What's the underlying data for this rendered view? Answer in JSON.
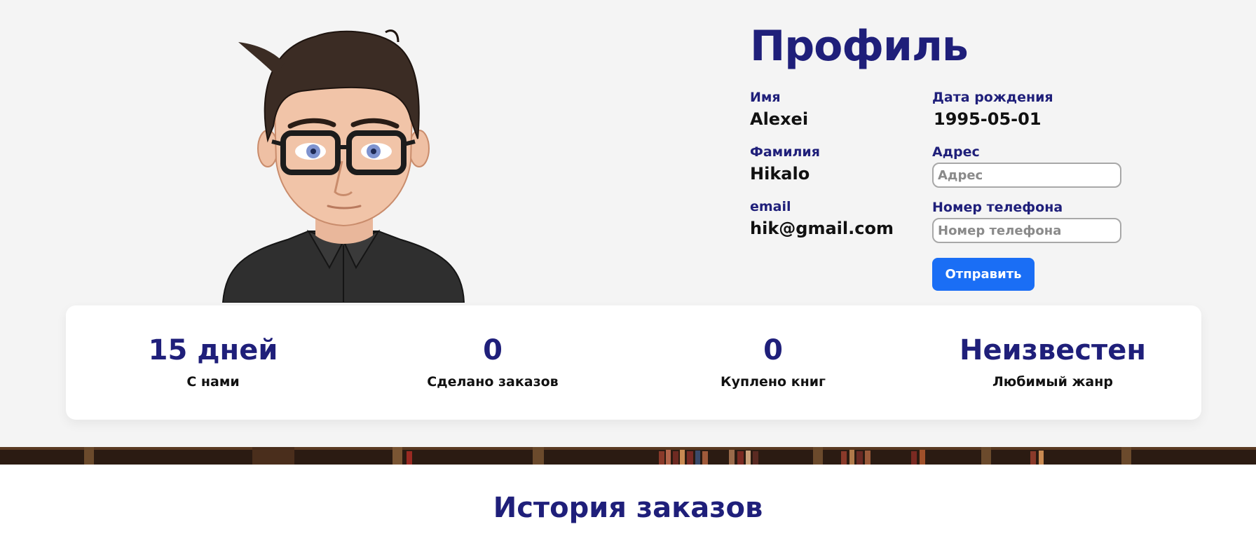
{
  "profile": {
    "title": "Профиль",
    "first_name_label": "Имя",
    "first_name": "Alexei",
    "last_name_label": "Фамилия",
    "last_name": "Hikalo",
    "email_label": "email",
    "email": "hik@gmail.com",
    "birthdate_label": "Дата рождения",
    "birthdate": "1995-05-01",
    "address_label": "Адрес",
    "address_placeholder": "Адрес",
    "address_value": "",
    "phone_label": "Номер телефона",
    "phone_placeholder": "Номер телефона",
    "phone_value": "",
    "submit_label": "Отправить"
  },
  "stats": [
    {
      "value": "15 дней",
      "label": "С нами"
    },
    {
      "value": "0",
      "label": "Сделано заказов"
    },
    {
      "value": "0",
      "label": "Куплено книг"
    },
    {
      "value": "Неизвестен",
      "label": "Любимый жанр"
    }
  ],
  "orders": {
    "title": "История заказов"
  },
  "colors": {
    "heading": "#1f1f7a",
    "button": "#1a6ef5",
    "background": "#f4f4f4"
  }
}
